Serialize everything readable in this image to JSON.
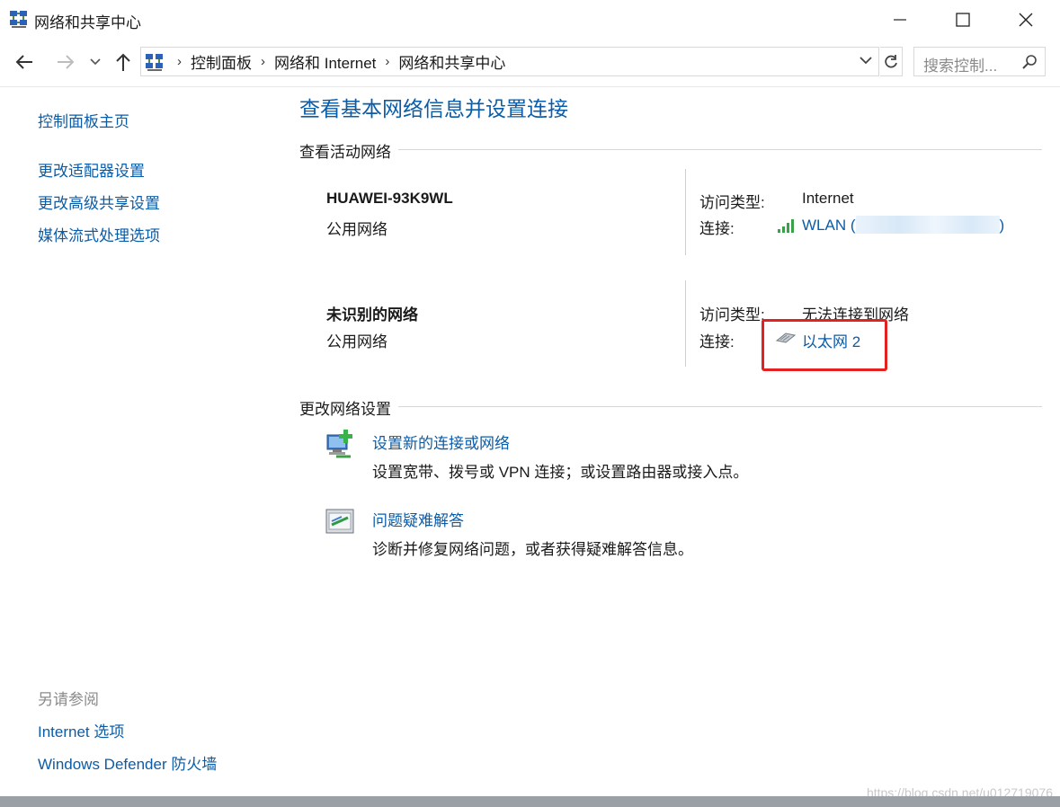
{
  "window": {
    "title": "网络和共享中心",
    "icon": "network-center-icon"
  },
  "address": {
    "crumbs": [
      "控制面板",
      "网络和 Internet",
      "网络和共享中心"
    ],
    "search_placeholder": "搜索控制..."
  },
  "sidebar": {
    "items": [
      {
        "label": "控制面板主页"
      },
      {
        "label": "更改适配器设置"
      },
      {
        "label": "更改高级共享设置"
      },
      {
        "label": "媒体流式处理选项"
      }
    ],
    "see_also_title": "另请参阅",
    "see_also": [
      {
        "label": "Internet 选项"
      },
      {
        "label": "Windows Defender 防火墙"
      }
    ]
  },
  "main": {
    "title": "查看基本网络信息并设置连接",
    "active_networks_title": "查看活动网络",
    "networks": [
      {
        "name": "HUAWEI-93K9WL",
        "type": "公用网络",
        "access_label": "访问类型:",
        "access_value": "Internet",
        "connection_label": "连接:",
        "connection_value_start": "WLAN (",
        "connection_value_end": ")",
        "connection_icon": "wifi-signal-icon"
      },
      {
        "name": "未识别的网络",
        "type": "公用网络",
        "access_label": "访问类型:",
        "access_value": "无法连接到网络",
        "connection_label": "连接:",
        "connection_value": "以太网 2",
        "connection_icon": "ethernet-icon"
      }
    ],
    "change_settings_title": "更改网络设置",
    "tasks": [
      {
        "link": "设置新的连接或网络",
        "desc": "设置宽带、拨号或 VPN 连接；或设置路由器或接入点。",
        "icon": "new-connection-icon"
      },
      {
        "link": "问题疑难解答",
        "desc": "诊断并修复网络问题，或者获得疑难解答信息。",
        "icon": "troubleshoot-icon"
      }
    ]
  },
  "watermark": "https://blog.csdn.net/u012719076",
  "colors": {
    "link": "#0b5ca8",
    "highlight": "#e32121"
  }
}
